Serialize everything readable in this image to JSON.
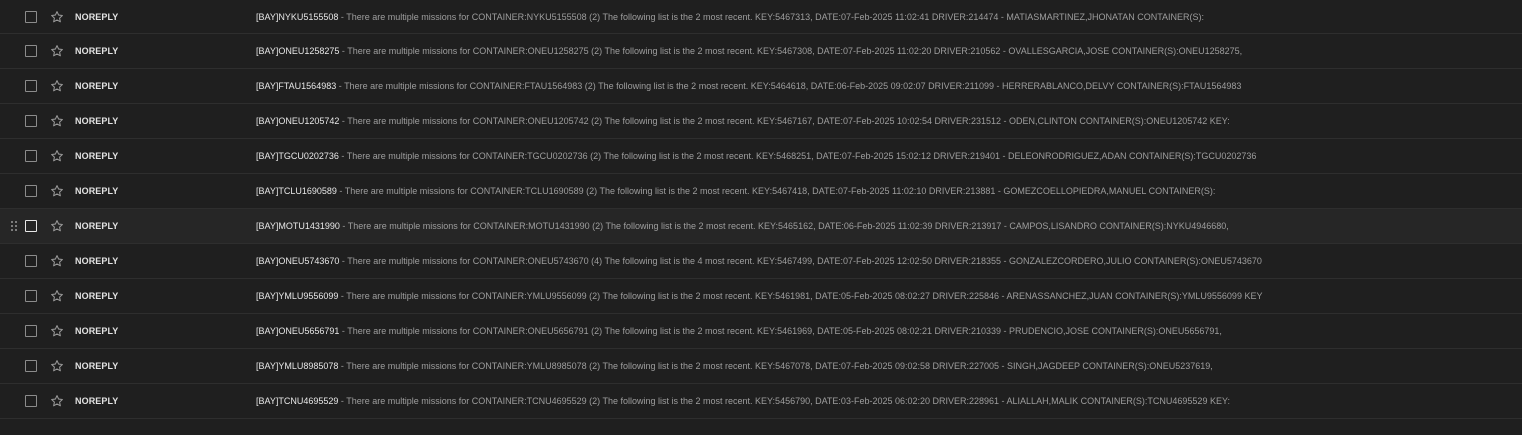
{
  "emails": [
    {
      "sender": "NOREPLY",
      "subject": "[BAY]NYKU5155508",
      "snippet": "There are multiple missions for CONTAINER:NYKU5155508 (2) The following list is the 2 most recent. KEY:5467313, DATE:07-Feb-2025 11:02:41 DRIVER:214474 - MATIASMARTINEZ,JHONATAN CONTAINER(S):"
    },
    {
      "sender": "NOREPLY",
      "subject": "[BAY]ONEU1258275",
      "snippet": "There are multiple missions for CONTAINER:ONEU1258275 (2) The following list is the 2 most recent. KEY:5467308, DATE:07-Feb-2025 11:02:20 DRIVER:210562 - OVALLESGARCIA,JOSE CONTAINER(S):ONEU1258275,"
    },
    {
      "sender": "NOREPLY",
      "subject": "[BAY]FTAU1564983",
      "snippet": "There are multiple missions for CONTAINER:FTAU1564983 (2) The following list is the 2 most recent. KEY:5464618, DATE:06-Feb-2025 09:02:07 DRIVER:211099 - HERRERABLANCO,DELVY CONTAINER(S):FTAU1564983"
    },
    {
      "sender": "NOREPLY",
      "subject": "[BAY]ONEU1205742",
      "snippet": "There are multiple missions for CONTAINER:ONEU1205742 (2) The following list is the 2 most recent. KEY:5467167, DATE:07-Feb-2025 10:02:54 DRIVER:231512 - ODEN,CLINTON CONTAINER(S):ONEU1205742 KEY:"
    },
    {
      "sender": "NOREPLY",
      "subject": "[BAY]TGCU0202736",
      "snippet": "There are multiple missions for CONTAINER:TGCU0202736 (2) The following list is the 2 most recent. KEY:5468251, DATE:07-Feb-2025 15:02:12 DRIVER:219401 - DELEONRODRIGUEZ,ADAN CONTAINER(S):TGCU0202736"
    },
    {
      "sender": "NOREPLY",
      "subject": "[BAY]TCLU1690589",
      "snippet": "There are multiple missions for CONTAINER:TCLU1690589 (2) The following list is the 2 most recent. KEY:5467418, DATE:07-Feb-2025 11:02:10 DRIVER:213881 - GOMEZCOELLOPIEDRA,MANUEL CONTAINER(S):"
    },
    {
      "sender": "NOREPLY",
      "subject": "[BAY]MOTU1431990",
      "snippet": "There are multiple missions for CONTAINER:MOTU1431990 (2) The following list is the 2 most recent. KEY:5465162, DATE:06-Feb-2025 11:02:39 DRIVER:213917 - CAMPOS,LISANDRO CONTAINER(S):NYKU4946680,",
      "hovered": true
    },
    {
      "sender": "NOREPLY",
      "subject": "[BAY]ONEU5743670",
      "snippet": "There are multiple missions for CONTAINER:ONEU5743670 (4) The following list is the 4 most recent. KEY:5467499, DATE:07-Feb-2025 12:02:50 DRIVER:218355 - GONZALEZCORDERO,JULIO CONTAINER(S):ONEU5743670"
    },
    {
      "sender": "NOREPLY",
      "subject": "[BAY]YMLU9556099",
      "snippet": "There are multiple missions for CONTAINER:YMLU9556099 (2) The following list is the 2 most recent. KEY:5461981, DATE:05-Feb-2025 08:02:27 DRIVER:225846 - ARENASSANCHEZ,JUAN CONTAINER(S):YMLU9556099 KEY"
    },
    {
      "sender": "NOREPLY",
      "subject": "[BAY]ONEU5656791",
      "snippet": "There are multiple missions for CONTAINER:ONEU5656791 (2) The following list is the 2 most recent. KEY:5461969, DATE:05-Feb-2025 08:02:21 DRIVER:210339 - PRUDENCIO,JOSE CONTAINER(S):ONEU5656791,"
    },
    {
      "sender": "NOREPLY",
      "subject": "[BAY]YMLU8985078",
      "snippet": "There are multiple missions for CONTAINER:YMLU8985078 (2) The following list is the 2 most recent. KEY:5467078, DATE:07-Feb-2025 09:02:58 DRIVER:227005 - SINGH,JAGDEEP CONTAINER(S):ONEU5237619,"
    },
    {
      "sender": "NOREPLY",
      "subject": "[BAY]TCNU4695529",
      "snippet": "There are multiple missions for CONTAINER:TCNU4695529 (2) The following list is the 2 most recent. KEY:5456790, DATE:03-Feb-2025 06:02:20 DRIVER:228961 - ALIALLAH,MALIK CONTAINER(S):TCNU4695529 KEY:"
    }
  ],
  "separator": " - ",
  "icons": {
    "checkbox": "checkbox-icon",
    "star": "star-icon",
    "drag": "drag-handle-icon"
  },
  "colors": {
    "background": "#1f1f1f",
    "row_border": "#2e2e2e",
    "subject": "#e8e8e8",
    "snippet": "#9e9e9e"
  }
}
